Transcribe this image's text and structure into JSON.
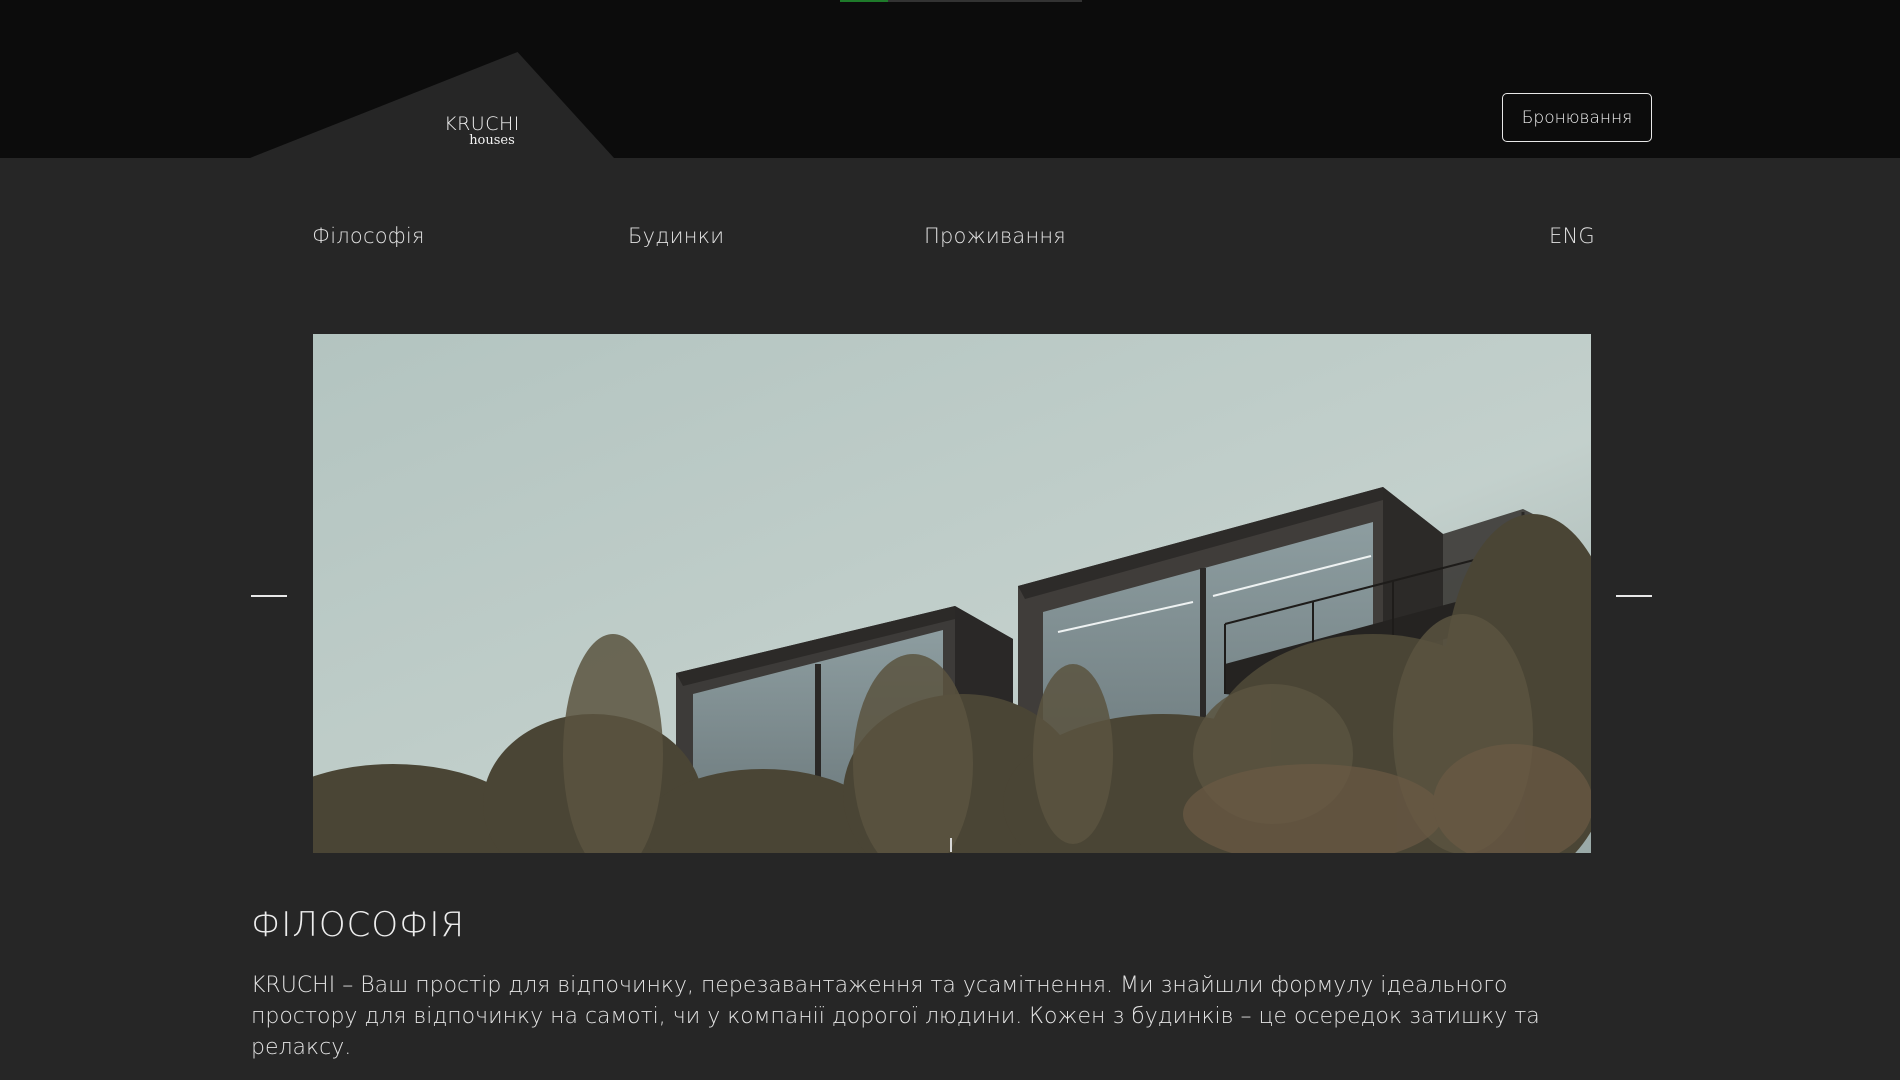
{
  "header": {
    "progress_fraction": 0.2,
    "logo": {
      "name": "KRUCHI",
      "sub": "houses"
    },
    "book_button": "Бронювання"
  },
  "nav": {
    "items": [
      "Філософія",
      "Будинки",
      "Проживання"
    ],
    "language": "ENG"
  },
  "slider": {
    "image": "modern-dark-cabins-on-hill-photo",
    "prev_icon": "minus-line-icon",
    "next_icon": "minus-line-icon"
  },
  "philosophy": {
    "title": "ФІЛОСОФІЯ",
    "paragraph1": "KRUCHI – Ваш простір для відпочинку, перезавантаження та усамітнення. Ми знайшли формулу ідеального простору для відпочинку на самоті, чи у компанії дорогої людини. Кожен з будинків – це осередок затишку та релаксу."
  },
  "colors": {
    "background": "#262626",
    "header": "#0c0c0c",
    "accent": "#1e7a2a"
  }
}
